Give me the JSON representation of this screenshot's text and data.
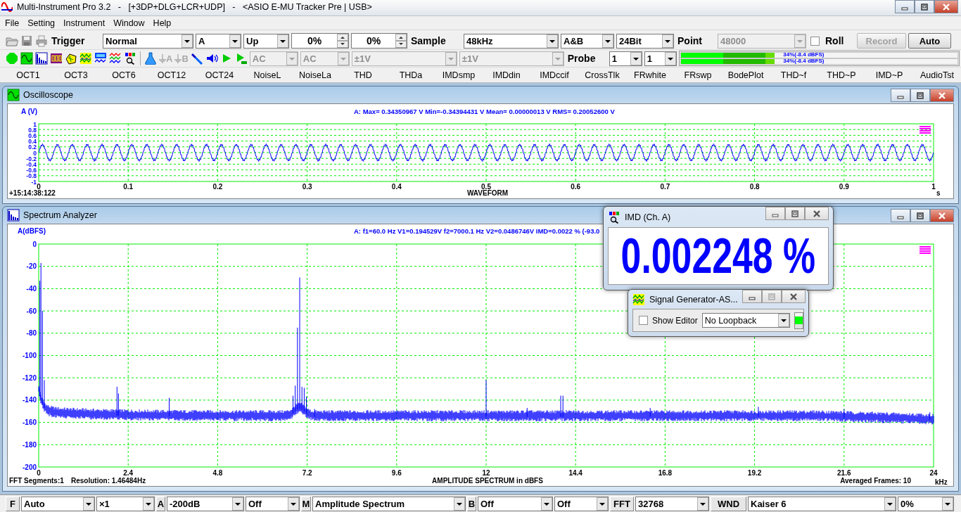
{
  "window": {
    "title": "Multi-Instrument Pro 3.2   -   [+3DP+DLG+LCR+UDP]   -   <ASIO E-MU Tracker Pre | USB>"
  },
  "menu": [
    "File",
    "Setting",
    "Instrument",
    "Window",
    "Help"
  ],
  "toolbar": {
    "items": [
      {
        "kind": "label",
        "text": "Trigger"
      },
      {
        "kind": "combo",
        "value": "Normal",
        "disabled": false
      },
      {
        "kind": "combo",
        "value": "A",
        "disabled": false
      },
      {
        "kind": "combo",
        "value": "Up",
        "disabled": false
      },
      {
        "kind": "spin",
        "value": "0%"
      },
      {
        "kind": "spin",
        "value": "0%"
      },
      {
        "kind": "label",
        "text": "Sample"
      },
      {
        "kind": "combo",
        "value": "48kHz",
        "disabled": false
      },
      {
        "kind": "combo",
        "value": "A&B",
        "disabled": false
      },
      {
        "kind": "combo",
        "value": "24Bit",
        "disabled": false
      },
      {
        "kind": "label",
        "text": "Point"
      },
      {
        "kind": "combo",
        "value": "48000",
        "disabled": true
      },
      {
        "kind": "check",
        "label": "Roll",
        "checked": false
      },
      {
        "kind": "button",
        "label": "Record",
        "disabled": true
      },
      {
        "kind": "button",
        "label": "Auto",
        "disabled": false
      }
    ]
  },
  "toolbar_2": {
    "ground_buttons": [
      "A",
      "B"
    ],
    "items": [
      {
        "kind": "combo",
        "value": "AC",
        "disabled": true
      },
      {
        "kind": "combo",
        "value": "AC",
        "disabled": true
      },
      {
        "kind": "combo",
        "value": "±1V",
        "disabled": true
      },
      {
        "kind": "combo",
        "value": "±1V",
        "disabled": true
      },
      {
        "kind": "label",
        "text": "Probe"
      },
      {
        "kind": "combo",
        "value": "1",
        "disabled": false
      },
      {
        "kind": "combo",
        "value": "1",
        "disabled": false
      },
      {
        "kind": "meter",
        "channels": [
          {
            "level": 0.34,
            "reading": "34%(-8.4 dBFS)"
          },
          {
            "level": 0.34,
            "reading": "34%(-8.4 dBFS)"
          }
        ]
      }
    ]
  },
  "instrument_tabs": [
    "OCT1",
    "OCT3",
    "OCT6",
    "OCT12",
    "OCT24",
    "NoiseL",
    "NoiseLa",
    "THD",
    "THDa",
    "IMDsmp",
    "IMDdin",
    "IMDccif",
    "CrossTlk",
    "FRwhite",
    "FRswp",
    "BodePlot",
    "THD~f",
    "THD~P",
    "IMD~P",
    "AudioTst"
  ],
  "oscilloscope": {
    "title": "Oscilloscope",
    "y_label": "A (V)",
    "stats": "A: Max= 0.34350967 V  Min=-0.34394431 V  Mean= 0.00000013 V  RMS= 0.20052600 V",
    "y_ticks": [
      "1",
      "0.8",
      "0.6",
      "0.4",
      "0.2",
      "0",
      "-0.2",
      "-0.4",
      "-0.6",
      "-0.8",
      "-1"
    ],
    "x_ticks": [
      "0",
      "0.1",
      "0.2",
      "0.3",
      "0.4",
      "0.5",
      "0.6",
      "0.7",
      "0.8",
      "0.9",
      "1"
    ],
    "x_unit": "s",
    "x_title": "WAVEFORM",
    "footer_left": [
      "+15:14:38:122"
    ]
  },
  "spectrum_analyzer": {
    "title": "Spectrum Analyzer",
    "y_label": "A(dBFS)",
    "stats": "A: f1=60.0 Hz V1=0.194529V  f2=7000.1 Hz V2=0.0486746V  IMD=0.0022 % (-93.0",
    "y_ticks": [
      "0",
      "-20",
      "-40",
      "-60",
      "-80",
      "-100",
      "-120",
      "-140",
      "-160",
      "-180",
      "-200"
    ],
    "x_ticks": [
      "0",
      "2.4",
      "4.8",
      "7.2",
      "9.6",
      "12",
      "14.4",
      "16.8",
      "19.2",
      "21.6",
      "24"
    ],
    "x_unit": "kHz",
    "x_title": "AMPLITUDE SPECTRUM in dBFS",
    "footer_left": [
      "FFT  Segments:1",
      "Resolution: 1.46484Hz"
    ],
    "footer_right": "Averaged Frames: 10"
  },
  "imd_window": {
    "title": "IMD (Ch. A)",
    "reading": "0.002248 %"
  },
  "signal_generator": {
    "title": "Signal Generator-AS...",
    "show_editor": {
      "label": "Show Editor",
      "checked": false
    },
    "loopback": "No Loopback",
    "running": true
  },
  "bottom_bar": {
    "items": [
      {
        "kind": "tag",
        "text": "F"
      },
      {
        "kind": "combo",
        "value": "Auto",
        "disabled": false
      },
      {
        "kind": "combo",
        "value": "×1",
        "disabled": false
      },
      {
        "kind": "tag",
        "text": "A"
      },
      {
        "kind": "combo",
        "value": "-200dB",
        "disabled": false
      },
      {
        "kind": "combo",
        "value": "Off",
        "disabled": false
      },
      {
        "kind": "tag",
        "text": "M"
      },
      {
        "kind": "combo",
        "value": "Amplitude Spectrum",
        "disabled": false
      },
      {
        "kind": "tag",
        "text": "B"
      },
      {
        "kind": "combo",
        "value": "Off",
        "disabled": false
      },
      {
        "kind": "combo",
        "value": "Off",
        "disabled": false
      },
      {
        "kind": "tag",
        "text": "FFT"
      },
      {
        "kind": "combo",
        "value": "32768",
        "disabled": false
      },
      {
        "kind": "tag",
        "text": "WND"
      },
      {
        "kind": "combo",
        "value": "Kaiser 6",
        "disabled": false
      },
      {
        "kind": "combo",
        "value": "0%",
        "disabled": false
      }
    ]
  }
}
